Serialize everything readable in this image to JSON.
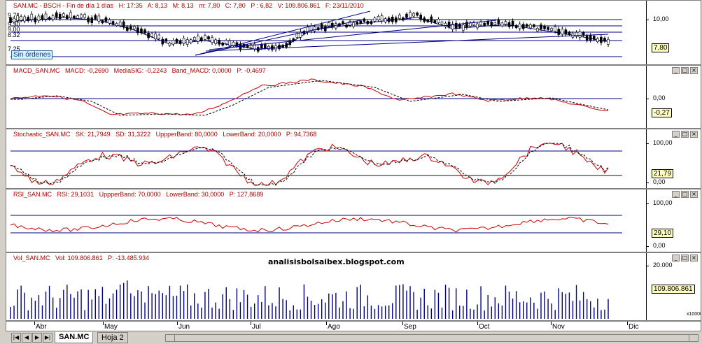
{
  "colors": {
    "price_up": "#000000",
    "price_down": "#000000",
    "ma_line": "#000080",
    "macd": "#cc0000",
    "signal": "#000000",
    "band": "#000080",
    "stoch_k": "#cc0000",
    "rsi": "#cc0000",
    "volume": "#000080"
  },
  "panes": {
    "price": {
      "title": [
        "SAN.MC - BSCH - Fin de día 1 días",
        "H: 17:35",
        "A: 8,13",
        "M: 8,13",
        "m: 7,80",
        "C: 7,80",
        "P : 6,82",
        "V: 109.806.861",
        "F: 23/11/2010"
      ],
      "axis": [
        "10,00"
      ],
      "left_labels": [
        "9.71",
        "9.30",
        "9.00",
        "8.32",
        "7.25"
      ],
      "current": "7,80",
      "orders_badge": "Sin órdenes"
    },
    "macd": {
      "title": [
        "MACD_SAN.MC",
        "MACD: -0,2690",
        "MediaSIG: -0,2243",
        "Band_MACD: 0,0000",
        "P: -0,4697"
      ],
      "axis": [
        "0,00"
      ],
      "current": "-0,27"
    },
    "stoch": {
      "title": [
        "Stochastic_SAN.MC",
        "SK: 21,7949",
        "SD: 31,3222",
        "UppperBand: 80,0000",
        "LowerBand: 20,0000",
        "P: 94,7368"
      ],
      "axis": [
        "100,00",
        "0,00"
      ],
      "current": "21,79"
    },
    "rsi": {
      "title": [
        "RSI_SAN.MC",
        "RSI: 29,1031",
        "UppperBand: 70,0000",
        "LowerBand: 30,0000",
        "P: 127,8689"
      ],
      "axis": [
        "100,00",
        "0,00"
      ],
      "current": "29,10"
    },
    "vol": {
      "title": [
        "Vol_SAN.MC",
        "Vol: 109.806.861",
        "P: -13.485.934"
      ],
      "axis": [
        "20.000"
      ],
      "current": "109.806.861",
      "scale_note": "x10000"
    }
  },
  "watermark": "analisisbolsaibex.blogspot.com",
  "months": [
    "Abr",
    "May",
    "Jun",
    "Jul",
    "Ago",
    "Sep",
    "Oct",
    "Nov",
    "Dic"
  ],
  "tabs": [
    "SAN.MC",
    "Hoja 2"
  ],
  "nav_buttons": [
    "first",
    "prev",
    "next",
    "last"
  ],
  "icons": {
    "minimize": "minimize-icon",
    "maximize": "maximize-icon",
    "close": "close-icon"
  }
}
